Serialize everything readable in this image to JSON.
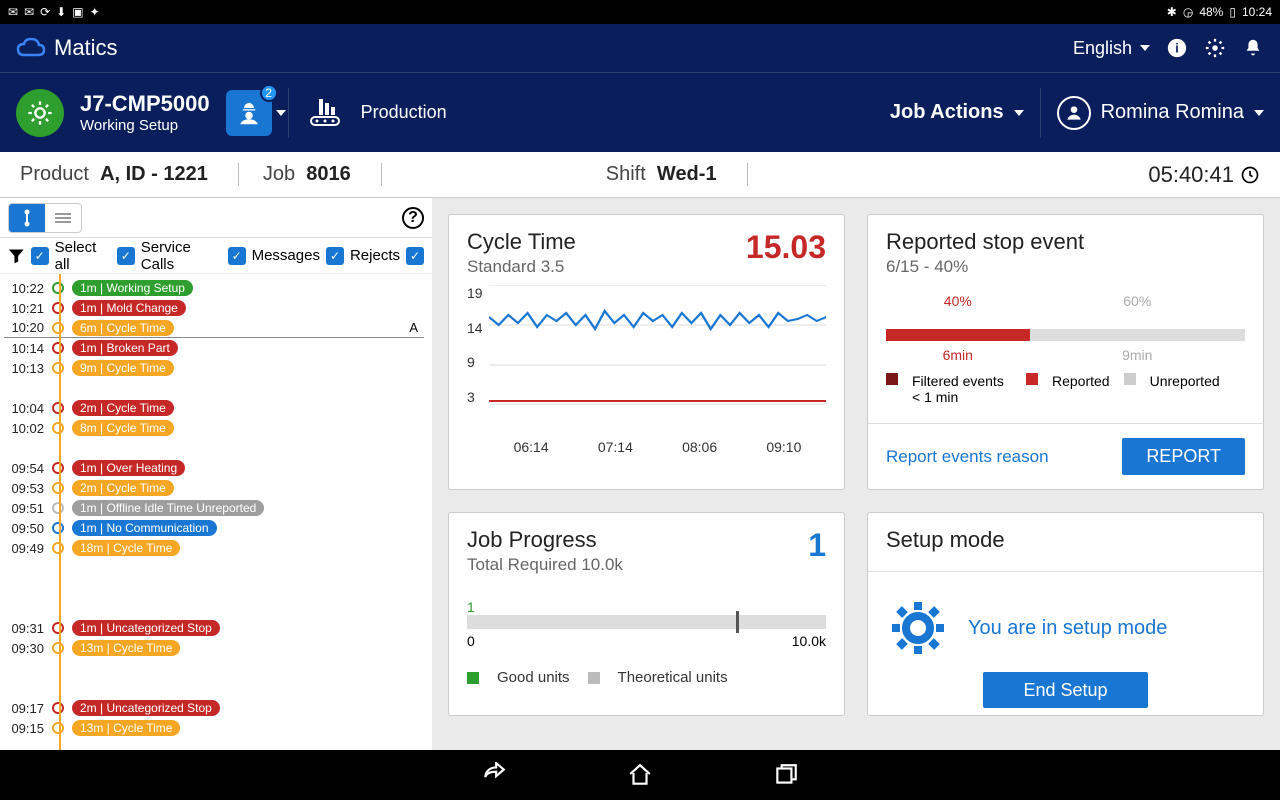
{
  "status_bar": {
    "battery": "48%",
    "time": "10:24"
  },
  "header": {
    "app_name": "Matics",
    "language": "English",
    "job_code": "J7-CMP5000",
    "job_status": "Working Setup",
    "worker_badge": "2",
    "mode": "Production",
    "job_actions": "Job Actions",
    "user_name": "Romina Romina"
  },
  "info_bar": {
    "product_label": "Product",
    "product_value": "A, ID - 1221",
    "job_label": "Job",
    "job_value": "8016",
    "shift_label": "Shift",
    "shift_value": "Wed-1",
    "timer": "05:40:41"
  },
  "filters": {
    "select_all": "Select all",
    "service_calls": "Service Calls",
    "messages": "Messages",
    "rejects": "Rejects"
  },
  "timeline": [
    {
      "time": "10:22",
      "dot": "#2e9e2e",
      "color": "#2e9e2e",
      "text": "1m | Working Setup"
    },
    {
      "time": "10:21",
      "dot": "#c62828",
      "color": "#c62828",
      "text": "1m | Mold Change"
    },
    {
      "time": "10:20",
      "dot": "#f5a623",
      "color": "#f5a623",
      "text": "6m | Cycle Time",
      "mark": "A"
    },
    {
      "time": "10:14",
      "dot": "#c62828",
      "color": "#c62828",
      "text": "1m | Broken Part"
    },
    {
      "time": "10:13",
      "dot": "#f5a623",
      "color": "#f5a623",
      "text": "9m | Cycle Time"
    },
    {
      "time": "",
      "dot": "",
      "color": "",
      "text": ""
    },
    {
      "time": "10:04",
      "dot": "#c62828",
      "color": "#c62828",
      "text": "2m | Cycle Time"
    },
    {
      "time": "10:02",
      "dot": "#f5a623",
      "color": "#f5a623",
      "text": "8m | Cycle Time"
    },
    {
      "time": "",
      "dot": "",
      "color": "",
      "text": ""
    },
    {
      "time": "09:54",
      "dot": "#c62828",
      "color": "#c62828",
      "text": "1m | Over Heating"
    },
    {
      "time": "09:53",
      "dot": "#f5a623",
      "color": "#f5a623",
      "text": "2m | Cycle Time"
    },
    {
      "time": "09:51",
      "dot": "#bbb",
      "color": "#9e9e9e",
      "text": "1m | Offline Idle Time Unreported"
    },
    {
      "time": "09:50",
      "dot": "#1976d2",
      "color": "#1976d2",
      "text": "1m | No Communication"
    },
    {
      "time": "09:49",
      "dot": "#f5a623",
      "color": "#f5a623",
      "text": "18m | Cycle Time"
    },
    {
      "time": "",
      "dot": "",
      "color": "",
      "text": ""
    },
    {
      "time": "",
      "dot": "",
      "color": "",
      "text": ""
    },
    {
      "time": "",
      "dot": "",
      "color": "",
      "text": ""
    },
    {
      "time": "09:31",
      "dot": "#c62828",
      "color": "#c62828",
      "text": "1m | Uncategorized Stop"
    },
    {
      "time": "09:30",
      "dot": "#f5a623",
      "color": "#f5a623",
      "text": "13m | Cycle Time"
    },
    {
      "time": "",
      "dot": "",
      "color": "",
      "text": ""
    },
    {
      "time": "",
      "dot": "",
      "color": "",
      "text": ""
    },
    {
      "time": "09:17",
      "dot": "#c62828",
      "color": "#c62828",
      "text": "2m | Uncategorized Stop"
    },
    {
      "time": "09:15",
      "dot": "#f5a623",
      "color": "#f5a623",
      "text": "13m | Cycle Time"
    }
  ],
  "cycle_time": {
    "title": "Cycle Time",
    "sub": "Standard 3.5",
    "value": "15.03",
    "y_ticks": [
      "19",
      "14",
      "9",
      "3"
    ],
    "x_ticks": [
      "06:14",
      "07:14",
      "08:06",
      "09:10"
    ]
  },
  "stop_event": {
    "title": "Reported stop event",
    "sub": "6/15 - 40%",
    "pct1": "40%",
    "pct2": "60%",
    "dur1": "6min",
    "dur2": "9min",
    "leg1": "Filtered events < 1 min",
    "leg2": "Reported",
    "leg3": "Unreported",
    "link": "Report events reason",
    "button": "REPORT"
  },
  "job_progress": {
    "title": "Job Progress",
    "sub": "Total Required 10.0k",
    "value": "1",
    "min": "0",
    "max": "10.0k",
    "cur": "1",
    "leg1": "Good units",
    "leg2": "Theoretical units"
  },
  "setup": {
    "title": "Setup mode",
    "text": "You are in setup mode",
    "button": "End Setup"
  },
  "chart_data": {
    "type": "line",
    "title": "Cycle Time",
    "ylabel": "",
    "ylim": [
      3,
      19
    ],
    "x": [
      "06:14",
      "07:14",
      "08:06",
      "09:10"
    ],
    "series": [
      {
        "name": "Cycle Time",
        "values_approx_center": 15,
        "note": "noisy line oscillating ~14-16"
      },
      {
        "name": "Standard",
        "values": [
          3.5,
          3.5,
          3.5,
          3.5
        ],
        "color": "#c62828"
      }
    ]
  }
}
